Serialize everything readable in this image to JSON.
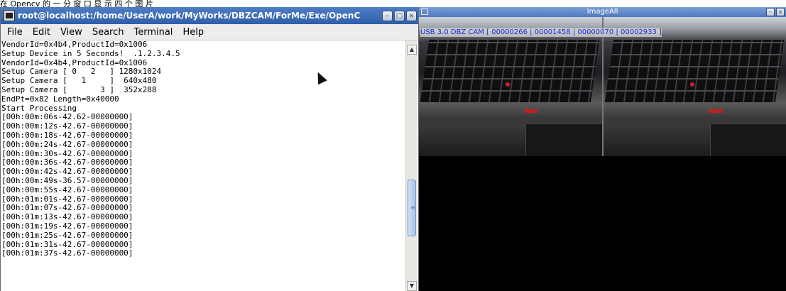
{
  "caption": {
    "text": "在 Opencv 的 一 分 窗 口 显 示 四 个 图 片"
  },
  "terminal": {
    "title": "root@localhost:/home/UserA/work/MyWorks/DBZCAM/ForMe/Exe/OpenC",
    "menu": [
      "File",
      "Edit",
      "View",
      "Search",
      "Terminal",
      "Help"
    ],
    "lines": [
      "VendorId=0x4b4,ProductId=0x1006",
      "Setup Device in 5 Seconds!  .1.2.3.4.5",
      "VendorId=0x4b4,ProductId=0x1006",
      "Setup Camera [ 0   2   ] 1280x1024",
      "Setup Camera [   1     ]  640x480",
      "Setup Camera [       3 ]  352x288",
      "EndPt=0x82 Length=0x40000",
      "Start Processing",
      "[00h:00m:06s-42.62-00000000]",
      "[00h:00m:12s-42.67-00000000]",
      "[00h:00m:18s-42.67-00000000]",
      "[00h:00m:24s-42.67-00000000]",
      "[00h:00m:30s-42.67-00000000]",
      "[00h:00m:36s-42.67-00000000]",
      "[00h:00m:42s-42.67-00000000]",
      "[00h:00m:49s-36.57-00000000]",
      "[00h:00m:55s-42.67-00000000]",
      "[00h:01m:01s-42.67-00000000]",
      "[00h:01m:07s-42.67-00000000]",
      "[00h:01m:13s-42.67-00000000]",
      "[00h:01m:19s-42.67-00000000]",
      "[00h:01m:25s-42.67-00000000]",
      "[00h:01m:31s-42.67-00000000]",
      "[00h:01m:37s-42.67-00000000]"
    ],
    "window_buttons": {
      "minimize": "–",
      "maximize": "□",
      "close": "×"
    },
    "scroll_up": "▲",
    "scroll_down": "▼",
    "scroll_grip": "≡"
  },
  "image_window": {
    "title": "ImageAll",
    "overlay": "USB 3.0 DBZ CAM [ 00000266 | 00001458 | 00000070 | 00002933 ]",
    "window_buttons": {
      "minimize": "–",
      "close": "×"
    }
  }
}
